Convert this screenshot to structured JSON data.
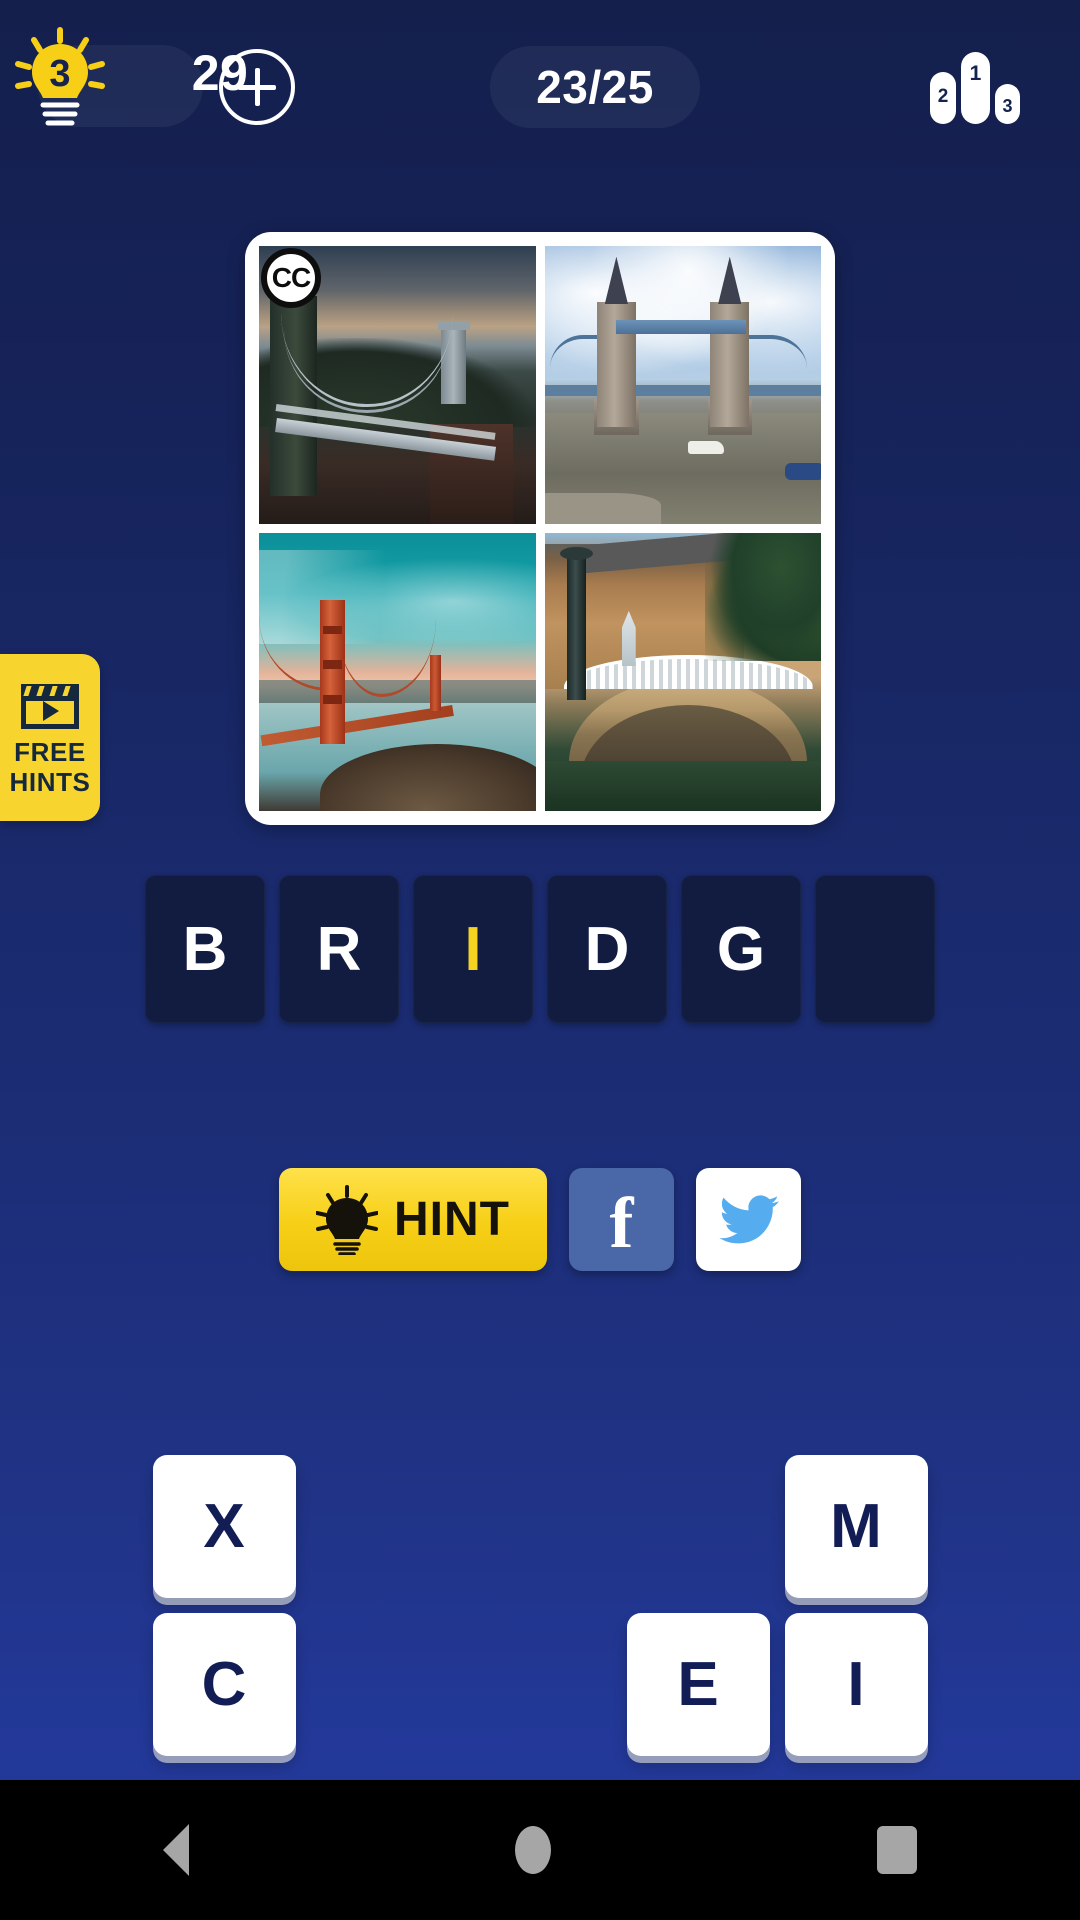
{
  "topbar": {
    "hint_bulb_icon": "lightbulb-icon",
    "hint_bulb_badge": "3",
    "hint_count": "29",
    "add_icon": "plus-icon",
    "progress": "23/25",
    "leaderboard_icon": "podium-icon",
    "podium_places": [
      "2",
      "1",
      "3"
    ]
  },
  "puzzle": {
    "cc_badge": "CC",
    "images": [
      {
        "name": "clifton-suspension-bridge"
      },
      {
        "name": "tower-bridge-london"
      },
      {
        "name": "golden-gate-bridge"
      },
      {
        "name": "plaza-de-espana-bridge"
      }
    ]
  },
  "free_hints": {
    "icon": "video-clapperboard-icon",
    "line1": "FREE",
    "line2": "HINTS"
  },
  "answer": {
    "slots": [
      {
        "letter": "B",
        "is_hint": false
      },
      {
        "letter": "R",
        "is_hint": false
      },
      {
        "letter": "I",
        "is_hint": true
      },
      {
        "letter": "D",
        "is_hint": false
      },
      {
        "letter": "G",
        "is_hint": false
      },
      {
        "letter": "",
        "is_hint": false
      }
    ],
    "word_length": 6
  },
  "actions": {
    "hint_label": "HINT",
    "hint_icon": "lightbulb-icon",
    "facebook_icon": "facebook-icon",
    "facebook_glyph": "f",
    "twitter_icon": "twitter-bird-icon"
  },
  "letter_tiles": [
    {
      "letter": "X",
      "row": 1,
      "col": 1
    },
    {
      "letter": "M",
      "row": 1,
      "col": 5
    },
    {
      "letter": "C",
      "row": 2,
      "col": 1
    },
    {
      "letter": "E",
      "row": 2,
      "col": 4
    },
    {
      "letter": "I",
      "row": 2,
      "col": 5
    }
  ],
  "navbar": {
    "back_icon": "back-triangle-icon",
    "home_icon": "home-circle-icon",
    "recents_icon": "recents-square-icon"
  },
  "colors": {
    "accent_yellow": "#F6CF16",
    "background_top": "#141F4C",
    "background_bottom": "#23399A",
    "slot_fill": "#121C41",
    "tile_text": "#121C55",
    "facebook_blue": "#4A67A8",
    "twitter_blue": "#55ACEE"
  }
}
